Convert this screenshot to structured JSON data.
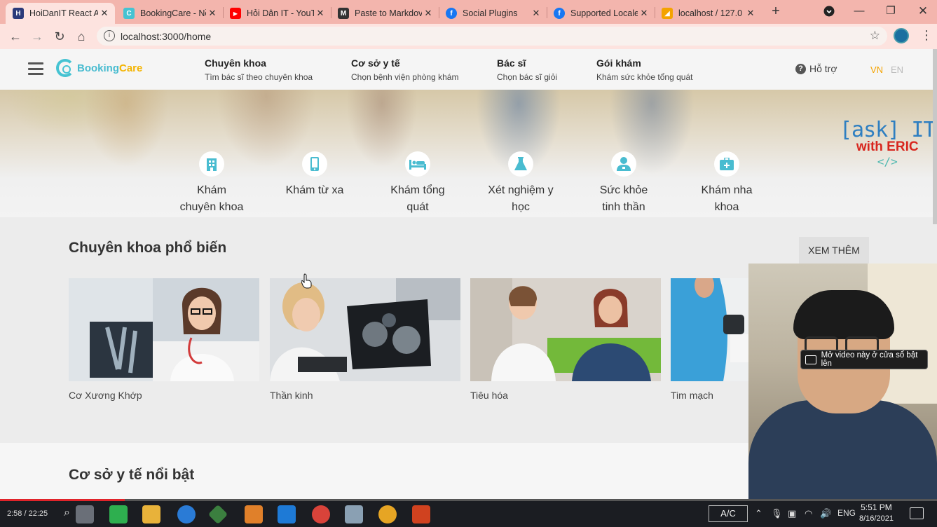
{
  "browser": {
    "tabs": [
      {
        "title": "HoiDanIT React A",
        "color": "#2b3a7a",
        "glyph": "H"
      },
      {
        "title": "BookingCare - Nề",
        "color": "#45c3d2",
        "glyph": "C"
      },
      {
        "title": "Hỏi Dân IT - YouT",
        "color": "#ff0000",
        "glyph": "▶"
      },
      {
        "title": "Paste to Markdov",
        "color": "#333333",
        "glyph": "M"
      },
      {
        "title": "Social Plugins",
        "color": "#1877f2",
        "glyph": "f"
      },
      {
        "title": "Supported Locale",
        "color": "#1877f2",
        "glyph": "f"
      },
      {
        "title": "localhost / 127.0",
        "color": "#f4a300",
        "glyph": "◢"
      }
    ],
    "new_tab": "+",
    "url": "localhost:3000/home"
  },
  "header": {
    "logo_prefix": "Booking",
    "logo_suffix": "Care",
    "nav": [
      {
        "title": "Chuyên khoa",
        "sub": "Tìm bác sĩ theo chuyên khoa"
      },
      {
        "title": "Cơ sở y tế",
        "sub": "Chọn bệnh viện phòng khám"
      },
      {
        "title": "Bác sĩ",
        "sub": "Chọn bác sĩ giỏi"
      },
      {
        "title": "Gói khám",
        "sub": "Khám sức khỏe tổng quát"
      }
    ],
    "support": "Hỗ trợ",
    "lang_vn": "VN",
    "lang_en": "EN"
  },
  "watermark": {
    "line1": "[ask] IT",
    "line2": "with ERIC",
    "line3": "</>"
  },
  "options": [
    {
      "label1": "Khám",
      "label2": "chuyên khoa",
      "icon": "hospital-icon"
    },
    {
      "label1": "Khám từ xa",
      "label2": "",
      "icon": "phone-icon"
    },
    {
      "label1": "Khám tổng",
      "label2": "quát",
      "icon": "bed-icon"
    },
    {
      "label1": "Xét nghiệm y",
      "label2": "học",
      "icon": "flask-icon"
    },
    {
      "label1": "Sức khỏe",
      "label2": "tinh thần",
      "icon": "user-doctor-icon"
    },
    {
      "label1": "Khám nha",
      "label2": "khoa",
      "icon": "medkit-icon"
    }
  ],
  "specialty": {
    "title": "Chuyên khoa phổ biến",
    "more": "XEM THÊM",
    "items": [
      {
        "name": "Cơ Xương Khớp"
      },
      {
        "name": "Thần kinh"
      },
      {
        "name": "Tiêu hóa"
      },
      {
        "name": "Tim mạch"
      }
    ]
  },
  "facility": {
    "title": "Cơ sở y tế nổi bật"
  },
  "overlay": {
    "pip_text": "Mở video này ở cửa sổ bật lên"
  },
  "video": {
    "time": "2:58 / 22:25",
    "progress": 0.133
  },
  "taskbar": {
    "ac": "A/C",
    "lang": "ENG",
    "time": "5:51 PM",
    "date": "8/16/2021"
  }
}
